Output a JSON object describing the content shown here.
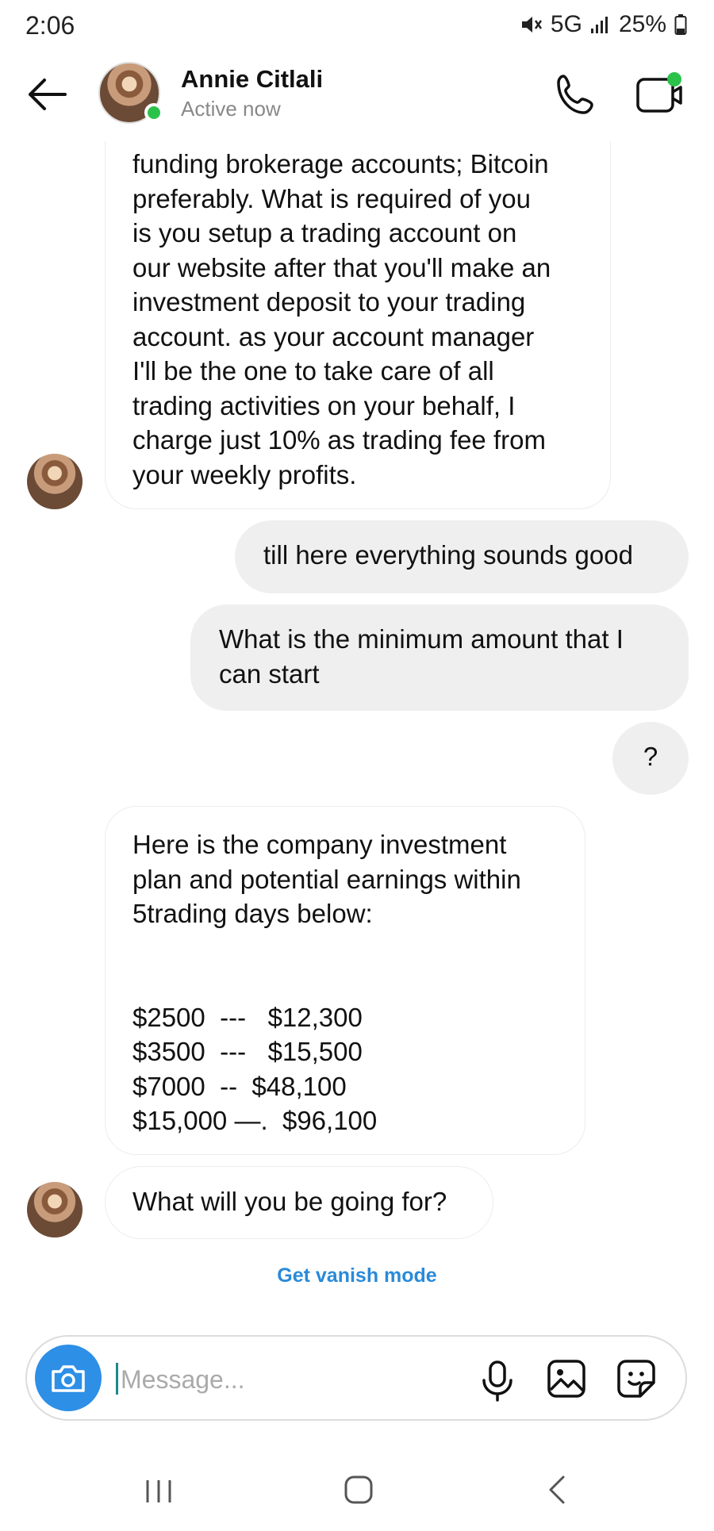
{
  "status_bar": {
    "time": "2:06",
    "network": "5G",
    "battery": "25%",
    "icons": [
      "mute-icon",
      "signal-icon",
      "battery-icon"
    ]
  },
  "header": {
    "contact_name": "Annie Citlali",
    "contact_status": "Active now",
    "icons": [
      "back-arrow-icon",
      "phone-icon",
      "video-icon"
    ],
    "presence_color": "#2bc24a"
  },
  "messages": [
    {
      "direction": "incoming",
      "lines": [
        "funding brokerage accounts; Bitcoin",
        "preferably. What is required of you",
        "is you setup a trading account on",
        "our website after that you'll make an",
        "investment deposit to your trading",
        "account. as your account manager",
        "I'll be the one to take care of all",
        "trading activities on your behalf, I",
        "charge just 10% as trading fee from",
        "your weekly profits."
      ]
    },
    {
      "direction": "outgoing",
      "lines": [
        "till here everything sounds good"
      ]
    },
    {
      "direction": "outgoing",
      "lines": [
        "What is the minimum amount that I",
        "can start"
      ]
    },
    {
      "direction": "outgoing",
      "lines": [
        "?"
      ]
    },
    {
      "direction": "incoming",
      "lines": [
        "Here is the company investment",
        "plan and potential earnings within",
        "5trading days below:",
        "",
        "",
        "$2500  ---   $12,300",
        "$3500  ---   $15,500",
        "$7000  --  $48,100",
        "$15,000 —.  $96,100"
      ]
    },
    {
      "direction": "incoming",
      "lines": [
        "What will you be going for?"
      ]
    }
  ],
  "vanish_mode": "Get vanish mode",
  "composer": {
    "placeholder": "Message...",
    "icons": [
      "camera-icon",
      "microphone-icon",
      "gallery-icon",
      "sticker-icon"
    ],
    "accent_color": "#2d8fe6"
  },
  "navigation": {
    "icons": [
      "recent-apps-icon",
      "home-icon",
      "back-icon"
    ]
  }
}
